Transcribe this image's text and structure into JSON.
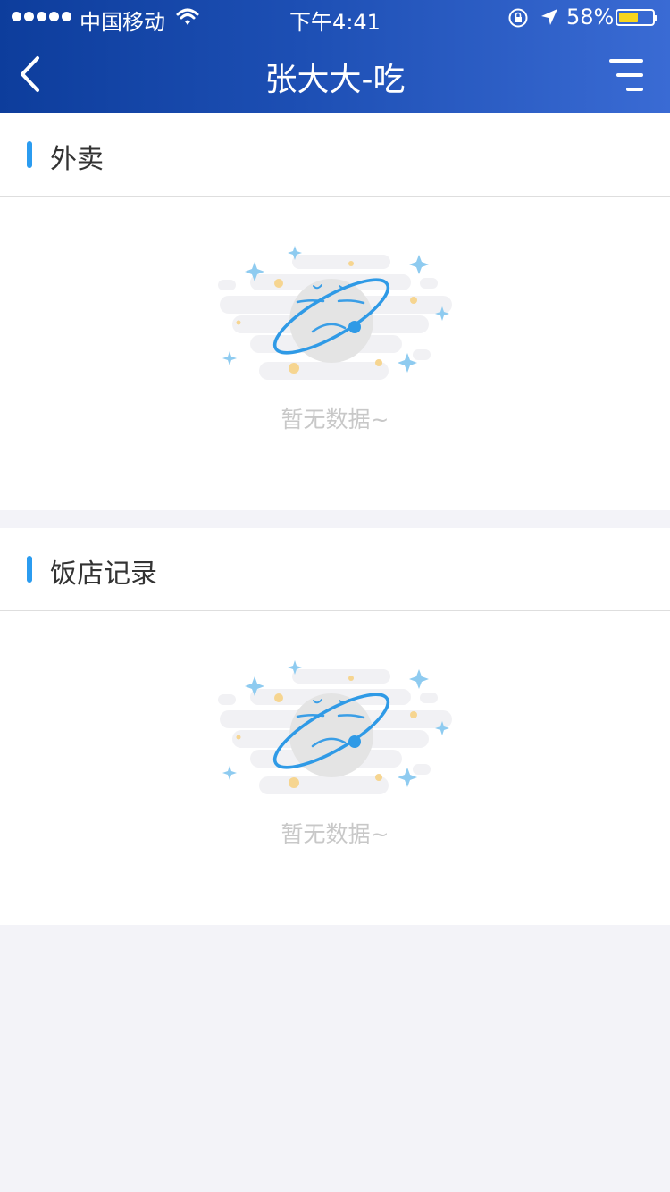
{
  "status_bar": {
    "carrier": "中国移动",
    "time": "下午4:41",
    "battery_percent": "58%",
    "battery_level": 0.58,
    "signal_bars": 5,
    "icons": [
      "wifi-icon",
      "rotation-lock-icon",
      "location-arrow-icon",
      "battery-icon"
    ]
  },
  "nav": {
    "title": "张大大-吃",
    "back_icon": "chevron-left-icon",
    "menu_icon": "filter-menu-icon"
  },
  "sections": [
    {
      "title": "外卖",
      "empty_text": "暂无数据~"
    },
    {
      "title": "饭店记录",
      "empty_text": "暂无数据~"
    }
  ],
  "colors": {
    "nav_start": "#0d3d9c",
    "nav_end": "#3a6bd4",
    "accent": "#2b9cf0",
    "background": "#f3f3f8",
    "empty_text": "#c8c8c8"
  }
}
